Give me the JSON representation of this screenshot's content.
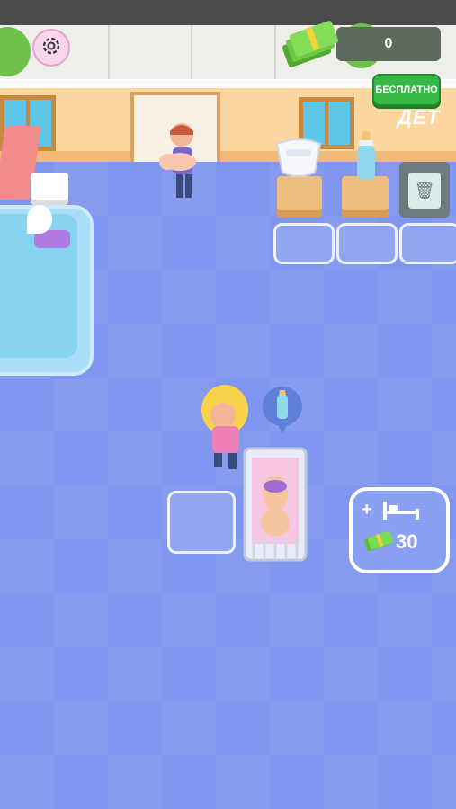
{
  "hud": {
    "money_value": "0",
    "free_button_label": "БЕСПЛАТНО",
    "settings_icon": "gear-icon",
    "money_icon": "cash-stack-icon"
  },
  "scene": {
    "wall_sign": "ДЕТ",
    "station_items": [
      "diaper-icon",
      "baby-bottle-icon",
      "trash-bin-icon"
    ],
    "request_bubble_icon": "baby-bottle-icon"
  },
  "upgrade": {
    "plus": "+",
    "icon": "bed-icon",
    "price": "30",
    "price_icon": "cash-stack-icon"
  },
  "colors": {
    "floor": "#7f95ef",
    "wall": "#fdd7a0",
    "free_button": "#35b944",
    "settings_button": "#f8d7ee"
  }
}
